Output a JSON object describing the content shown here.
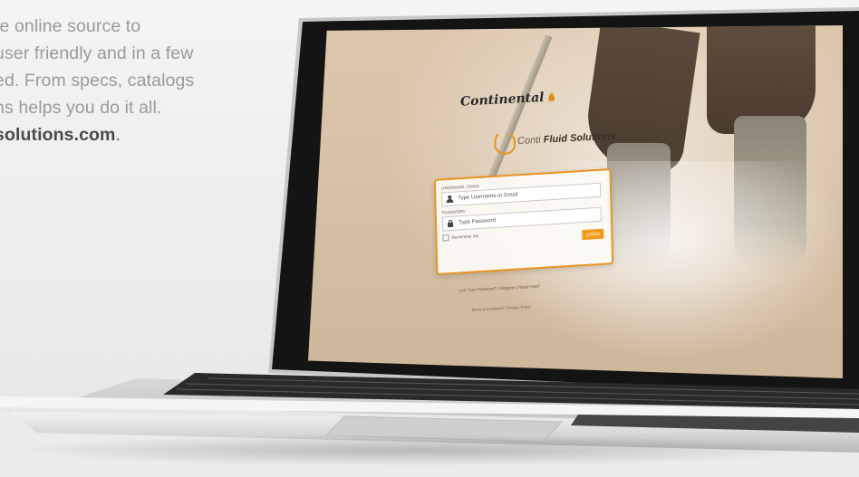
{
  "intro": {
    "line1": "te online source to",
    "line2": "user friendly and in a few",
    "line3": "ed. From specs, catalogs",
    "line4": "ns helps you do it all.",
    "line5_url": "solutions.com",
    "line5_tail": "."
  },
  "screen": {
    "brand_logo": "Continental",
    "product_logo_prefix": "Conti",
    "product_logo_name": "Fluid Solutions",
    "login": {
      "username_label": "USERNAME / EMAIL",
      "username_placeholder": "Type Username or Email",
      "password_label": "PASSWORD",
      "password_placeholder": "Type Password",
      "remember_label": "Remember Me",
      "submit_label": "LOGIN"
    },
    "links_line1": "Lost Your Password? | Register | Need Help?",
    "links_line2": "Terms & Conditions | Privacy Policy"
  },
  "colors": {
    "accent": "#f19a1c",
    "screen_bg": "#dcc7ad",
    "text_gray": "#9a9a9a"
  }
}
